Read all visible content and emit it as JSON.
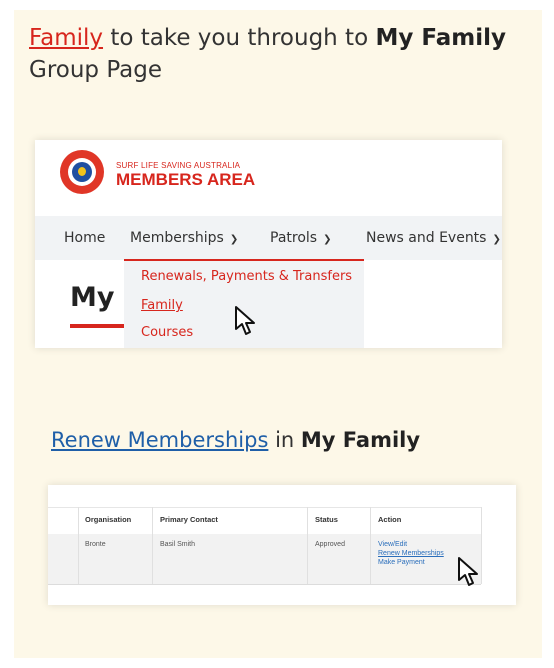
{
  "step1": {
    "link": "Family",
    "text1": " to take you through to ",
    "bold": "My Family",
    "text2": " Group Page"
  },
  "shot1": {
    "brand_small": "SURF LIFE SAVING AUSTRALIA",
    "brand_big": "MEMBERS AREA",
    "nav": {
      "home": "Home",
      "memberships": "Memberships",
      "patrols": "Patrols",
      "news": "News and Events"
    },
    "dropdown": [
      "Renewals, Payments & Transfers",
      "Family",
      "Courses"
    ],
    "heading": "My"
  },
  "step2": {
    "link": "Renew Memberships",
    "text1": " in ",
    "bold": "My Family"
  },
  "shot2": {
    "headers": [
      "Organisation",
      "Primary Contact",
      "Status",
      "Action"
    ],
    "row": {
      "organisation": "Bronte",
      "primary_contact": "Basil Smith",
      "status": "Approved",
      "actions": [
        "View/Edit",
        "Renew Memberships",
        "Make Payment"
      ]
    }
  },
  "colors": {
    "accent_red": "#d7261d",
    "link_blue": "#1f5fa8",
    "card_bg": "#fdf8e8"
  },
  "icons": [
    "cursor-icon",
    "chevron-down-icon",
    "slsa-logo-icon"
  ]
}
